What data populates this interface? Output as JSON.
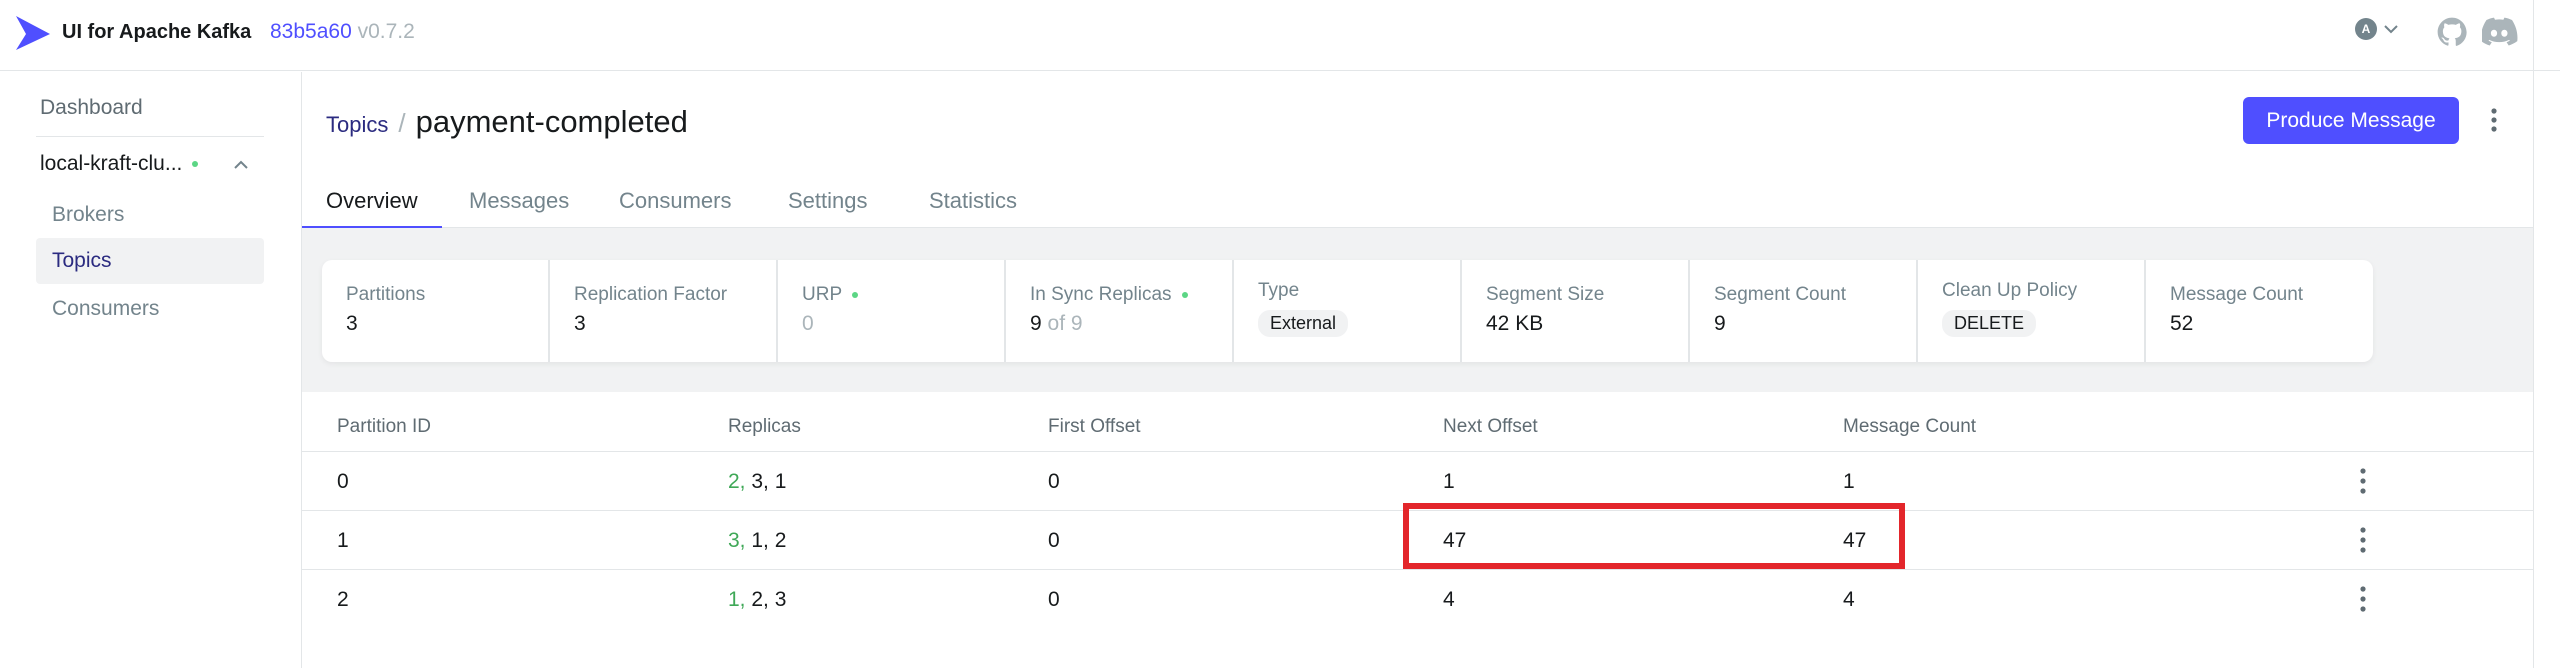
{
  "header": {
    "app_title": "UI for Apache Kafka",
    "commit_hash": "83b5a60",
    "version": "v0.7.2",
    "avatar_letter": "A"
  },
  "sidebar": {
    "dashboard": "Dashboard",
    "cluster_name": "local-kraft-clu...",
    "items": [
      {
        "label": "Brokers",
        "active": false
      },
      {
        "label": "Topics",
        "active": true
      },
      {
        "label": "Consumers",
        "active": false
      }
    ]
  },
  "breadcrumb": {
    "parent": "Topics",
    "separator": "/",
    "title": "payment-completed"
  },
  "actions": {
    "produce_label": "Produce Message"
  },
  "tabs": [
    "Overview",
    "Messages",
    "Consumers",
    "Settings",
    "Statistics"
  ],
  "stats": {
    "partitions": {
      "label": "Partitions",
      "value": "3"
    },
    "replication_factor": {
      "label": "Replication Factor",
      "value": "3"
    },
    "urp": {
      "label": "URP",
      "value": "0"
    },
    "in_sync": {
      "label": "In Sync Replicas",
      "value": "9",
      "of_text": "of 9"
    },
    "type": {
      "label": "Type",
      "value": "External"
    },
    "segment_size": {
      "label": "Segment Size",
      "value": "42 KB"
    },
    "segment_count": {
      "label": "Segment Count",
      "value": "9"
    },
    "cleanup_policy": {
      "label": "Clean Up Policy",
      "value": "DELETE"
    },
    "message_count": {
      "label": "Message Count",
      "value": "52"
    }
  },
  "table": {
    "headers": [
      "Partition ID",
      "Replicas",
      "First Offset",
      "Next Offset",
      "Message Count"
    ],
    "rows": [
      {
        "partition": "0",
        "leader": "2,",
        "replicas": " 3, 1",
        "first": "0",
        "next": "1",
        "count": "1"
      },
      {
        "partition": "1",
        "leader": "3,",
        "replicas": " 1, 2",
        "first": "0",
        "next": "47",
        "count": "47"
      },
      {
        "partition": "2",
        "leader": "1,",
        "replicas": " 2, 3",
        "first": "0",
        "next": "4",
        "count": "4"
      }
    ]
  },
  "colors": {
    "accent": "#4f4fff",
    "highlight": "#e3262b",
    "online": "#5cd685",
    "leader": "#3fa857"
  }
}
